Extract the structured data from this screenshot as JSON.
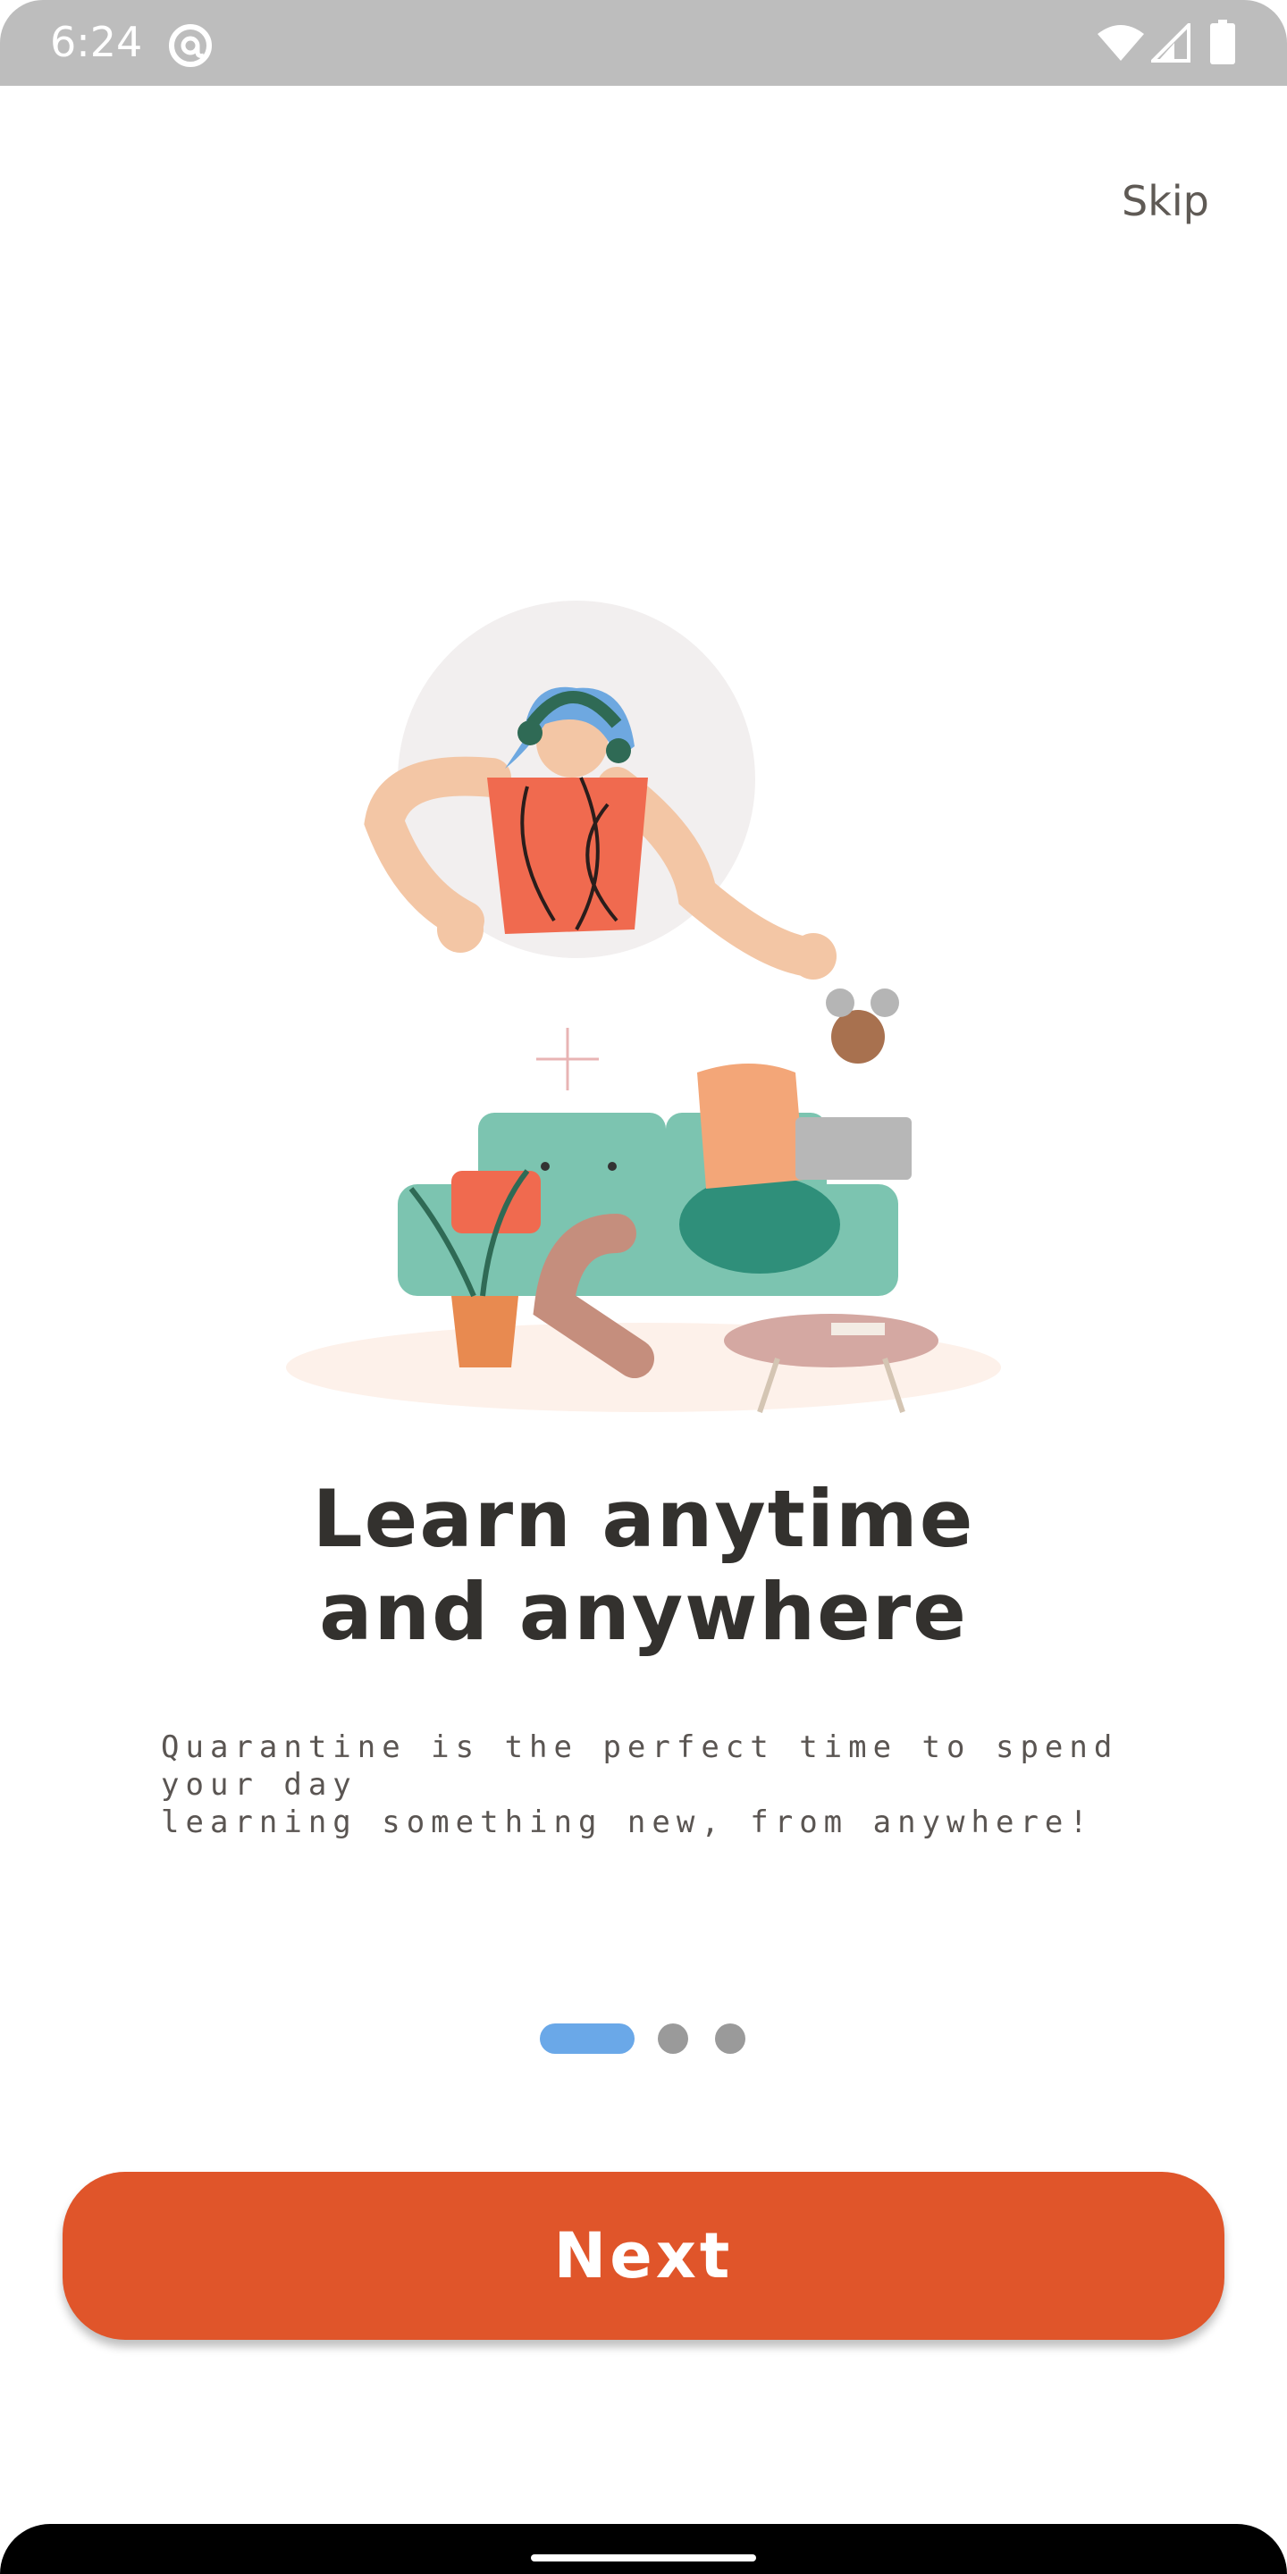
{
  "status_bar": {
    "time": "6:24",
    "icons": [
      "at-sign-icon",
      "wifi-icon",
      "signal-icon",
      "battery-icon"
    ]
  },
  "header": {
    "skip_label": "Skip"
  },
  "onboarding": {
    "title_line1": "Learn anytime",
    "title_line2": "and anywhere",
    "subtitle_line1": "Quarantine is the perfect time to spend your day",
    "subtitle_line2": "learning something new, from anywhere!",
    "page_indicator": {
      "current": 1,
      "total": 3
    }
  },
  "actions": {
    "next_label": "Next"
  },
  "colors": {
    "accent": "#e0552a",
    "indicator_active": "#6aa8e8",
    "indicator_inactive": "#9a9a9a",
    "title_text": "#33312e"
  }
}
